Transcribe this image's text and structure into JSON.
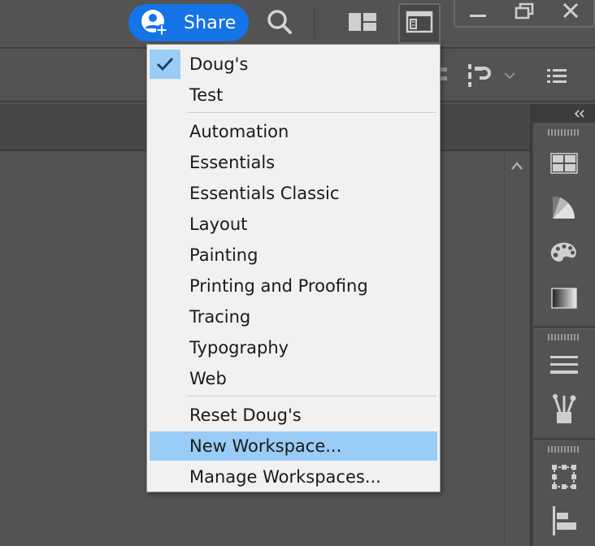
{
  "appbar": {
    "share_label": "Share"
  },
  "workspace_menu": {
    "sections": [
      [
        {
          "label": "Doug's",
          "checked": true
        },
        {
          "label": "Test",
          "checked": false
        }
      ],
      [
        {
          "label": "Automation"
        },
        {
          "label": "Essentials"
        },
        {
          "label": "Essentials Classic"
        },
        {
          "label": "Layout"
        },
        {
          "label": "Painting"
        },
        {
          "label": "Printing and Proofing"
        },
        {
          "label": "Tracing"
        },
        {
          "label": "Typography"
        },
        {
          "label": "Web"
        }
      ],
      [
        {
          "label": "Reset Doug's"
        },
        {
          "label": "New Workspace...",
          "highlighted": true
        },
        {
          "label": "Manage Workspaces..."
        }
      ]
    ]
  },
  "icons": {
    "share": "user-plus-icon",
    "search": "search-icon",
    "arrange_documents": "arrange-documents-icon",
    "workspace": "workspace-window-icon",
    "minimize": "minimize-icon",
    "restore": "restore-icon",
    "close": "close-icon",
    "align": "align-icon",
    "distribute": "distribute-icon",
    "list": "list-icon",
    "collapse_panels": "double-chevron-left-icon",
    "scroll_up": "chevron-up-icon",
    "dock": [
      "swatches-icon",
      "color-guide-icon",
      "palette-icon",
      "gradient-icon",
      "stroke-icon",
      "brushes-icon",
      "transform-icon",
      "align-panel-icon"
    ]
  },
  "colors": {
    "accent": "#1473e6",
    "menu_highlight": "#99ccf6",
    "menu_background": "#f1f1f1",
    "chrome": "#535353"
  }
}
